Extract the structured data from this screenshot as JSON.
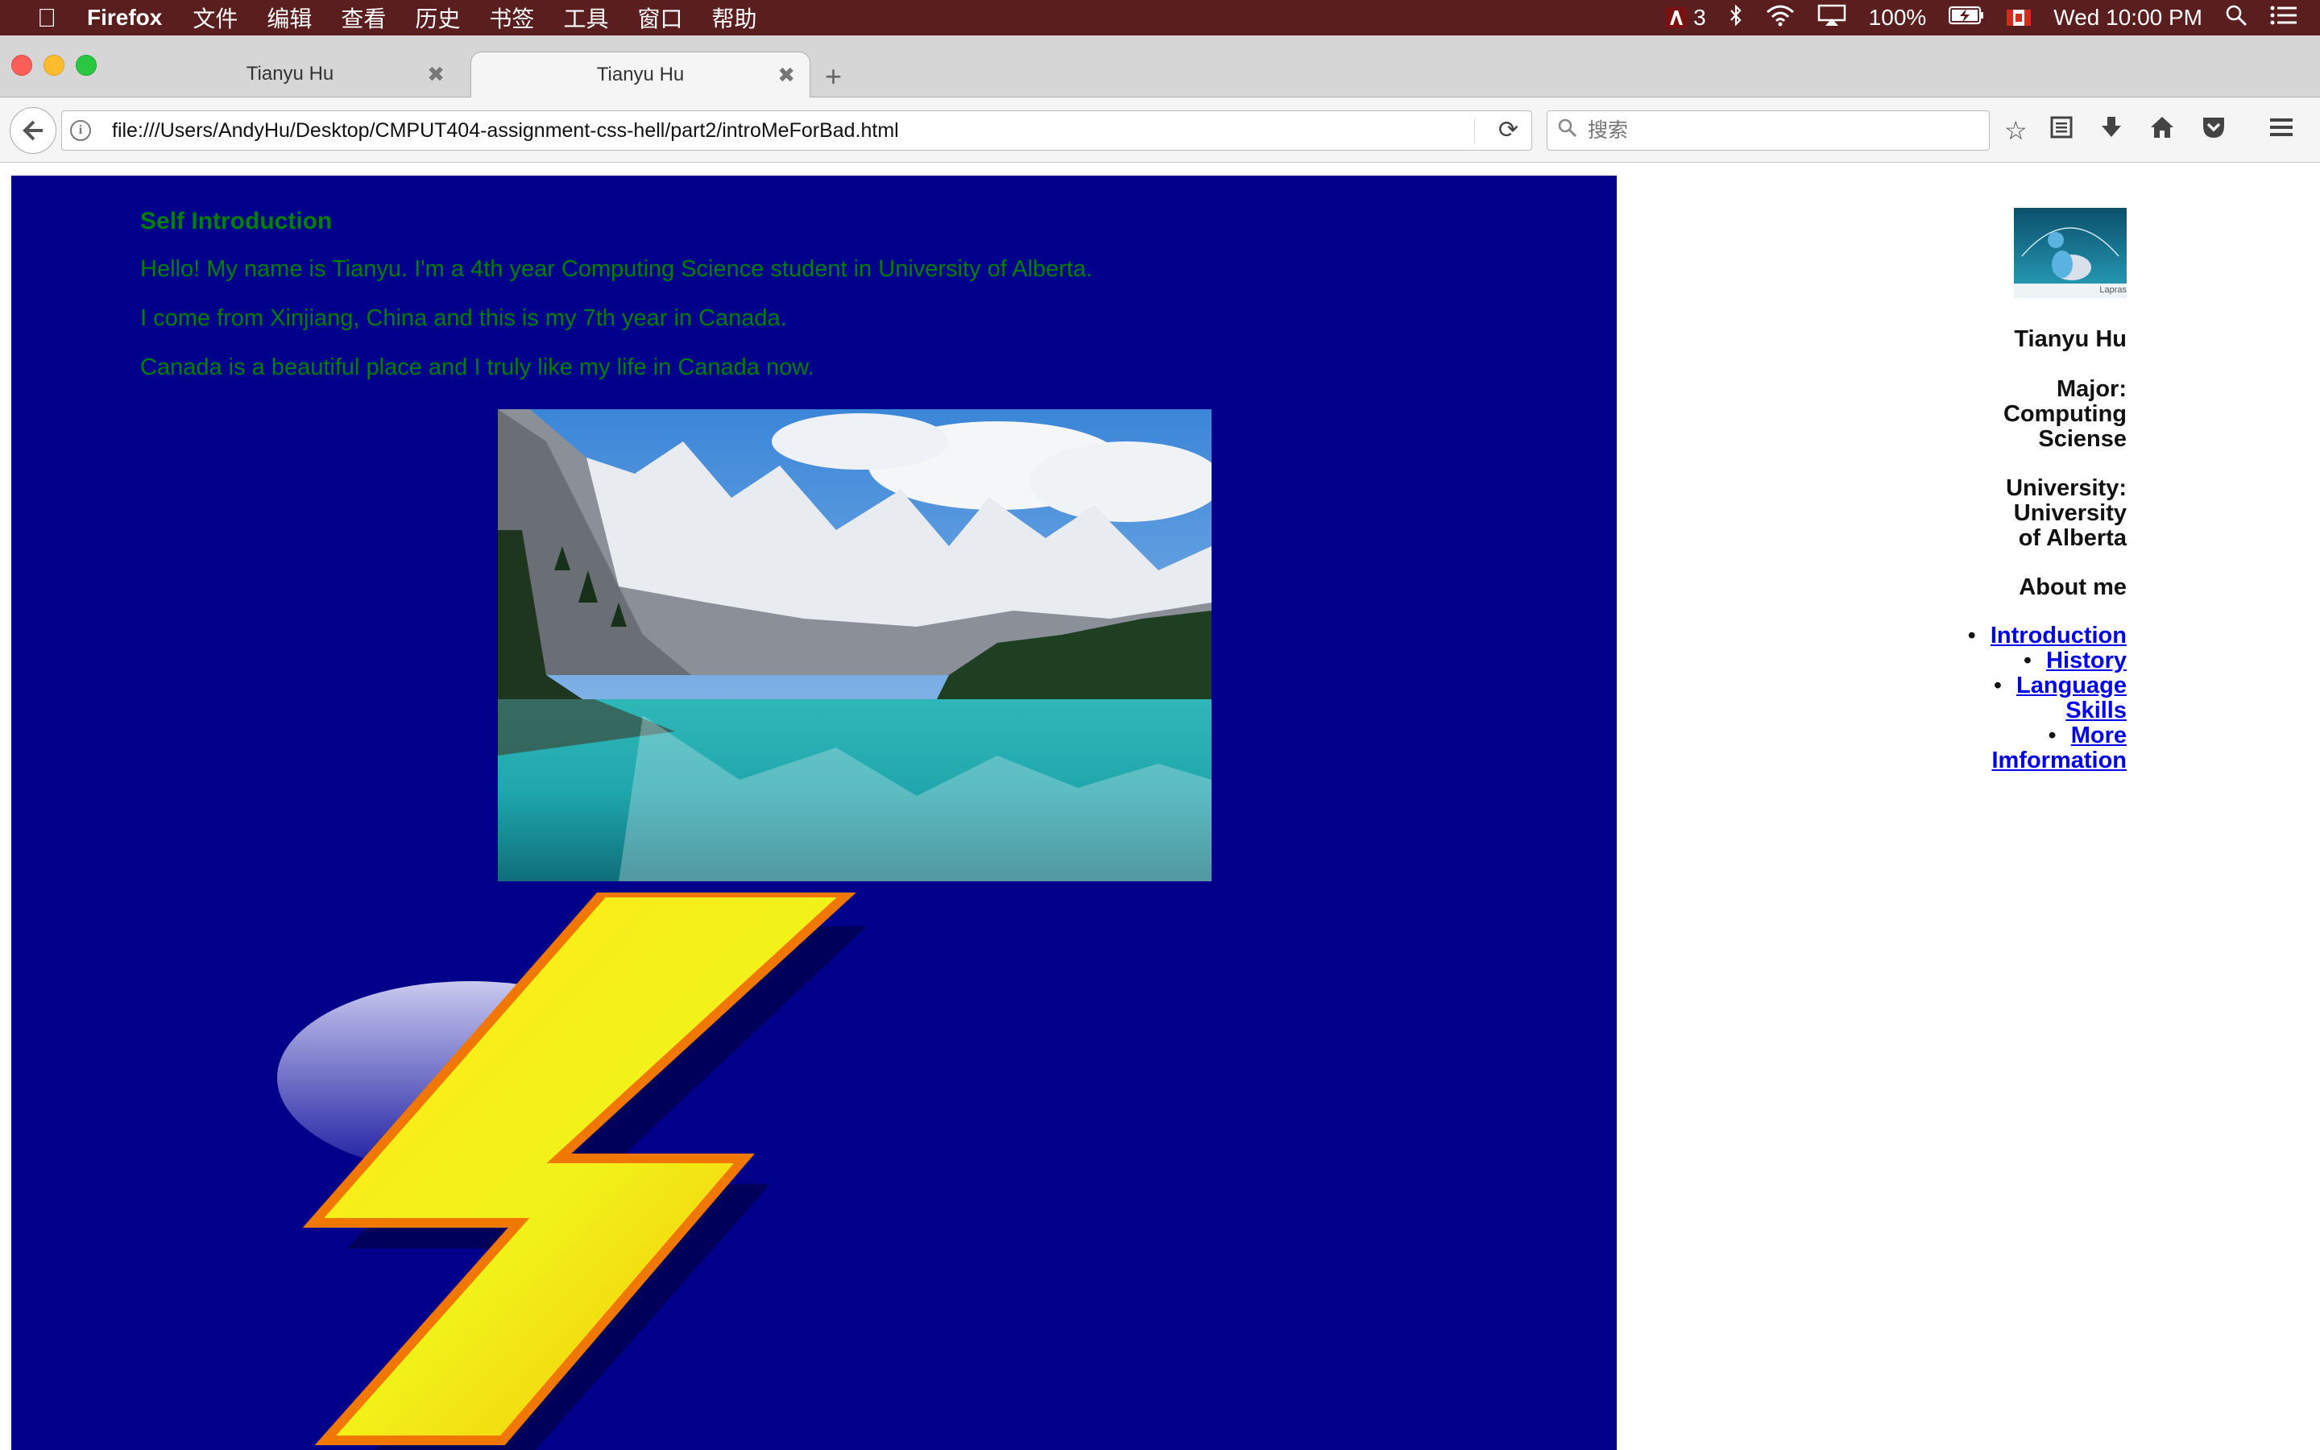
{
  "menubar": {
    "app_name": "Firefox",
    "items": [
      "文件",
      "编辑",
      "查看",
      "历史",
      "书签",
      "工具",
      "窗口",
      "帮助"
    ],
    "status": {
      "adobe_count": "3",
      "battery": "100%",
      "datetime": "Wed 10:00 PM"
    }
  },
  "tabs": [
    {
      "title": "Tianyu Hu",
      "active": false
    },
    {
      "title": "Tianyu Hu",
      "active": true
    }
  ],
  "navbar": {
    "url": "file:///Users/AndyHu/Desktop/CMPUT404-assignment-css-hell/part2/introMeForBad.html",
    "search_placeholder": "搜索"
  },
  "page": {
    "heading": "Self Introduction",
    "paragraphs": [
      "Hello! My name is Tianyu. I'm a 4th year Computing Science student in University of Alberta.",
      "I come from Xinjiang, China and this is my 7th year in Canada.",
      "Canada is a beautiful place and I truly like my life in Canada now."
    ],
    "colors": {
      "panel_background": "#00008b",
      "text": "#008000",
      "link": "#0000ee"
    }
  },
  "sidebar": {
    "avatar_caption": "Lapras",
    "name": "Tianyu Hu",
    "major_lines": [
      "Major:",
      "Computing",
      "Sciense"
    ],
    "university_lines": [
      "University:",
      "University",
      "of Alberta"
    ],
    "about_title": "About me",
    "links": [
      {
        "label_lines": [
          "Introduction"
        ]
      },
      {
        "label_lines": [
          "History"
        ]
      },
      {
        "label_lines": [
          "Language",
          "Skills"
        ]
      },
      {
        "label_lines": [
          "More",
          "Imformation"
        ]
      }
    ]
  }
}
